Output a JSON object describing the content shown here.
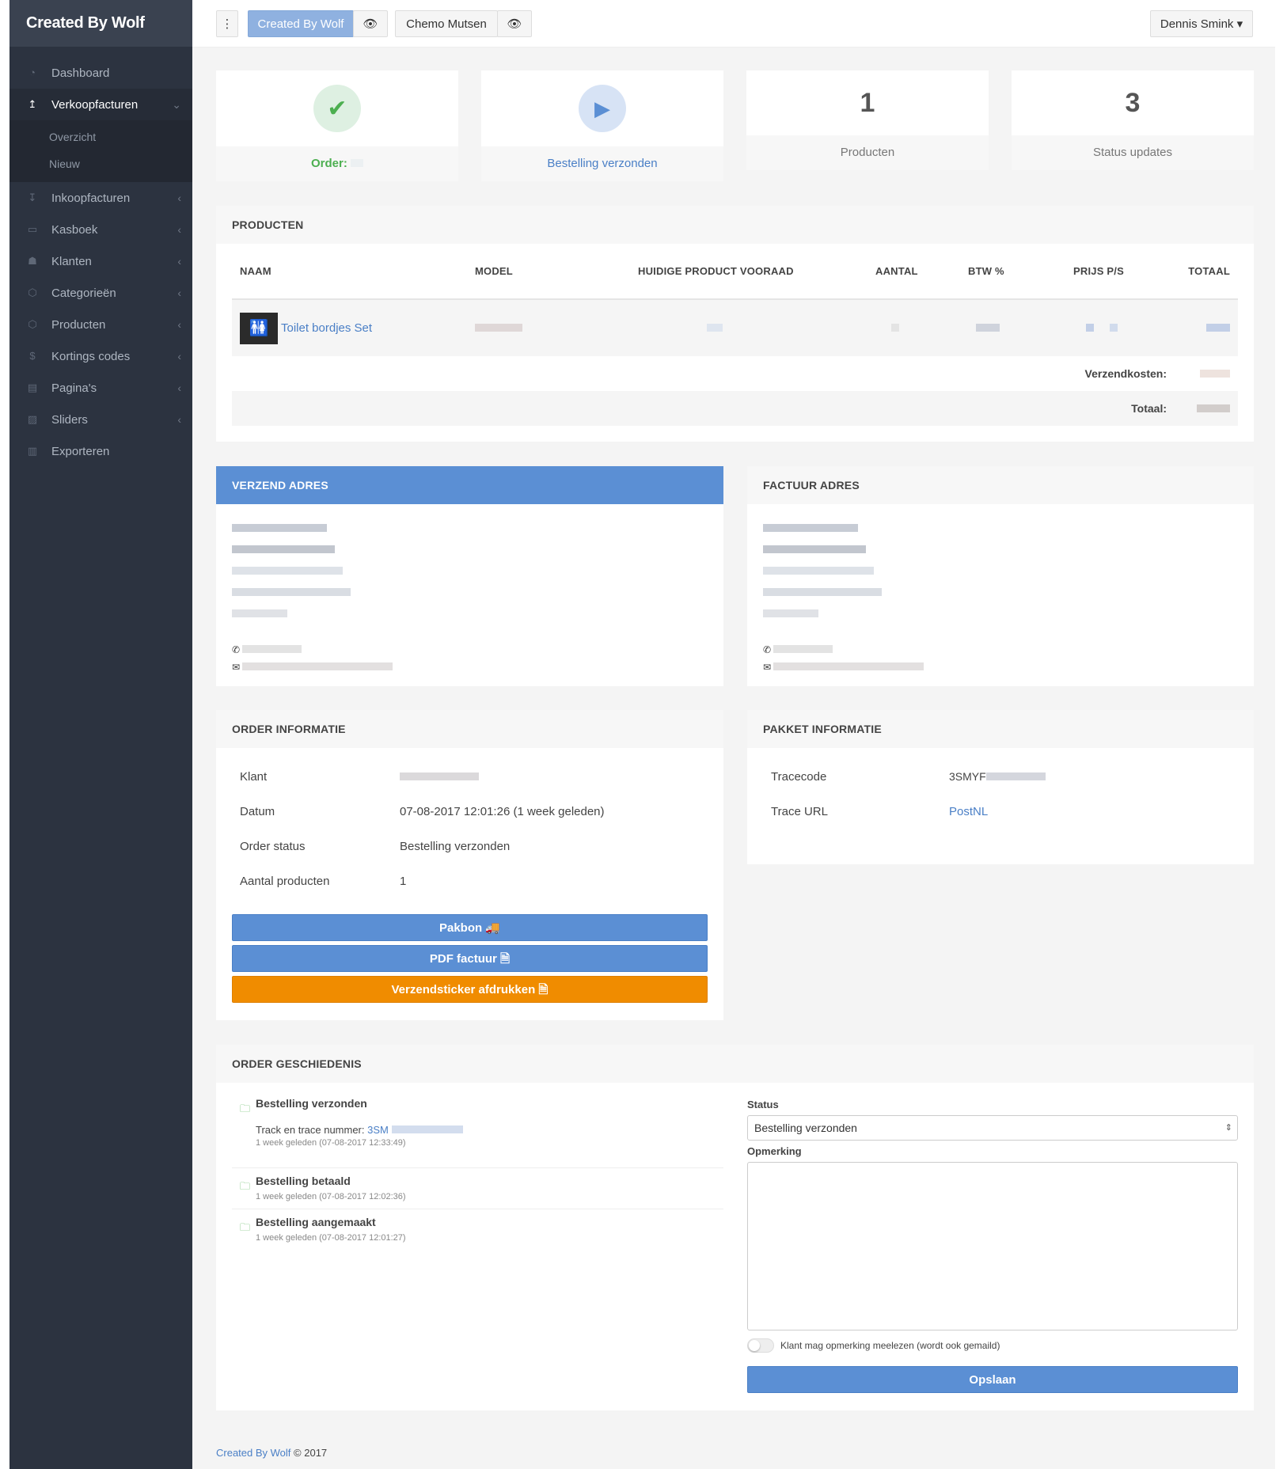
{
  "sidebar": {
    "brand": "Created By Wolf",
    "items": [
      {
        "label": "Dashboard",
        "icon": "dashboard-icon"
      },
      {
        "label": "Verkoopfacturen",
        "icon": "upload-arrow-icon",
        "active": true,
        "sub": [
          "Overzicht",
          "Nieuw"
        ]
      },
      {
        "label": "Inkoopfacturen",
        "icon": "download-arrow-icon"
      },
      {
        "label": "Kasboek",
        "icon": "cash-icon"
      },
      {
        "label": "Klanten",
        "icon": "users-icon"
      },
      {
        "label": "Categorieën",
        "icon": "cube-icon"
      },
      {
        "label": "Producten",
        "icon": "cube-icon"
      },
      {
        "label": "Kortings codes",
        "icon": "dollar-icon"
      },
      {
        "label": "Pagina's",
        "icon": "file-icon"
      },
      {
        "label": "Sliders",
        "icon": "image-icon"
      },
      {
        "label": "Exporteren",
        "icon": "export-icon"
      }
    ]
  },
  "topbar": {
    "menu": "⋮",
    "shop1": "Created By Wolf",
    "shop2": "Chemo Mutsen",
    "user": "Dennis Smink ▾"
  },
  "stats": {
    "order": {
      "label": "Order:",
      "icon": "check-icon",
      "color": "#4caf50"
    },
    "status": {
      "label": "Bestelling verzonden",
      "icon": "play-icon",
      "color": "#5b8fd4"
    },
    "products": {
      "num": "1",
      "label": "Producten"
    },
    "updates": {
      "num": "3",
      "label": "Status updates"
    }
  },
  "producten": {
    "title": "PRODUCTEN",
    "headers": [
      "NAAM",
      "MODEL",
      "HUIDIGE PRODUCT VOORAAD",
      "AANTAL",
      "BTW %",
      "PRIJS P/S",
      "TOTAAL"
    ],
    "product_name": "Toilet bordjes Set",
    "shipping_label": "Verzendkosten:",
    "total_label": "Totaal:"
  },
  "verzend": {
    "title": "VERZEND ADRES"
  },
  "factuur": {
    "title": "FACTUUR ADRES"
  },
  "order_info": {
    "title": "ORDER INFORMATIE",
    "rows": [
      {
        "k": "Klant",
        "v": ""
      },
      {
        "k": "Datum",
        "v": "07-08-2017 12:01:26 (1 week geleden)"
      },
      {
        "k": "Order status",
        "v": "Bestelling verzonden"
      },
      {
        "k": "Aantal producten",
        "v": "1"
      }
    ],
    "btn_pakbon": "Pakbon 🚚",
    "btn_pdf": "PDF factuur 🗎",
    "btn_sticker": "Verzendsticker afdrukken 🗎"
  },
  "pakket": {
    "title": "PAKKET INFORMATIE",
    "trace_label": "Tracecode",
    "trace_val": "3SMYF",
    "url_label": "Trace URL",
    "url_val": "PostNL"
  },
  "history": {
    "title": "ORDER GESCHIEDENIS",
    "entries": [
      {
        "title": "Bestelling verzonden",
        "track_label": "Track en trace nummer:",
        "track_val": "3SM",
        "sub": "1 week geleden (07-08-2017 12:33:49)"
      },
      {
        "title": "Bestelling betaald",
        "sub": "1 week geleden (07-08-2017 12:02:36)"
      },
      {
        "title": "Bestelling aangemaakt",
        "sub": "1 week geleden (07-08-2017 12:01:27)"
      }
    ],
    "status_label": "Status",
    "status_val": "Bestelling verzonden",
    "remark_label": "Opmerking",
    "toggle_label": "Klant mag opmerking meelezen (wordt ook gemaild)",
    "save": "Opslaan"
  },
  "footer": {
    "brand": "Created By Wolf",
    "rest": "© 2017"
  }
}
